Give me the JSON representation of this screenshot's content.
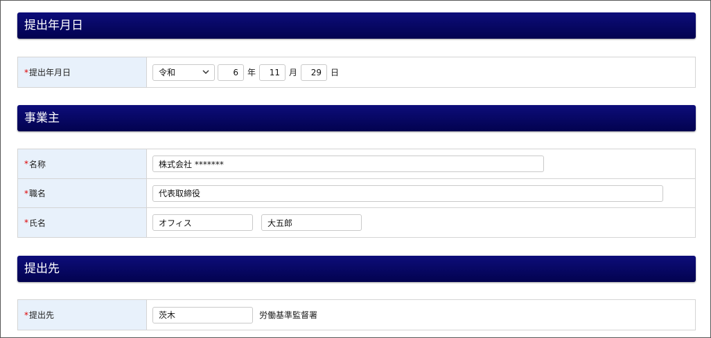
{
  "sections": {
    "date": {
      "title": "提出年月日",
      "label": "提出年月日",
      "era": "令和",
      "year": "6",
      "year_unit": "年",
      "month": "11",
      "month_unit": "月",
      "day": "29",
      "day_unit": "日"
    },
    "employer": {
      "title": "事業主",
      "name_label": "名称",
      "name_value": "株式会社 *******",
      "position_label": "職名",
      "position_value": "代表取締役",
      "person_label": "氏名",
      "last_name": "オフィス",
      "first_name": "大五郎"
    },
    "destination": {
      "title": "提出先",
      "label": "提出先",
      "value": "茨木",
      "suffix": "労働基準監督署"
    }
  },
  "required_mark": "*"
}
